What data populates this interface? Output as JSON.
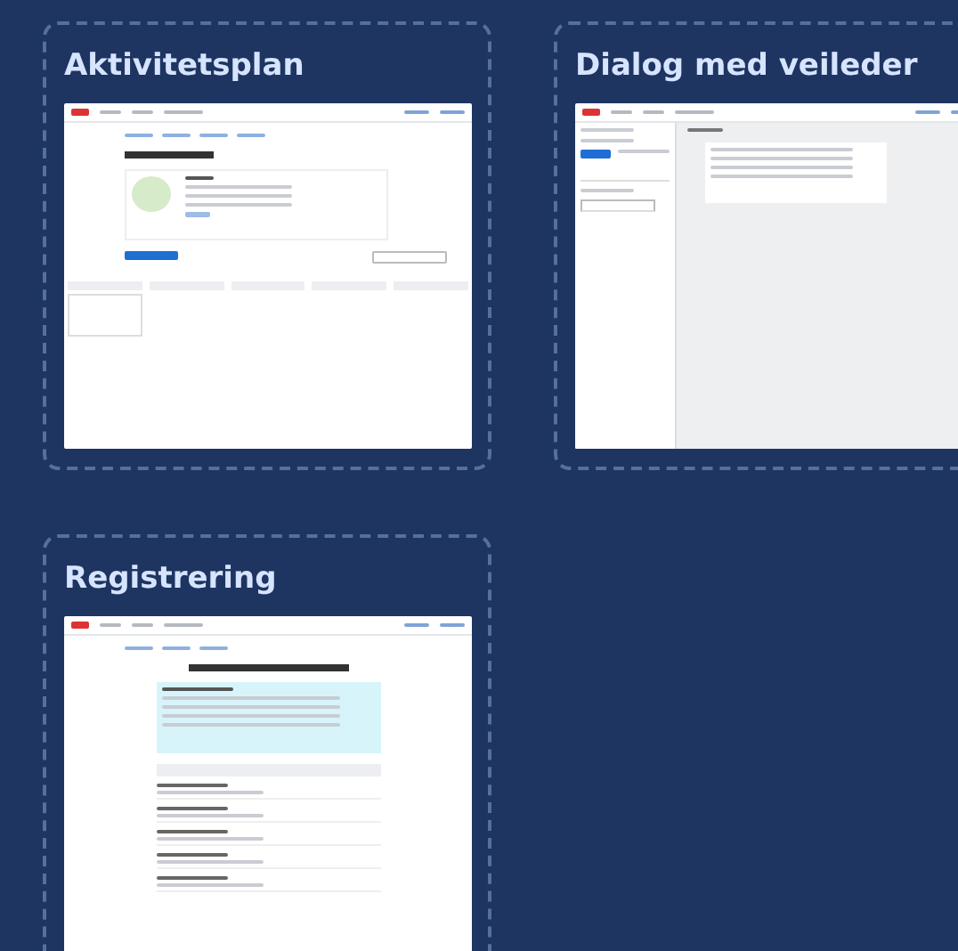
{
  "cards": [
    {
      "title": "Aktivitetsplan",
      "kind": "plan"
    },
    {
      "title": "Dialog med veileder",
      "kind": "dialog"
    },
    {
      "title": "Registrering",
      "kind": "registration"
    }
  ]
}
